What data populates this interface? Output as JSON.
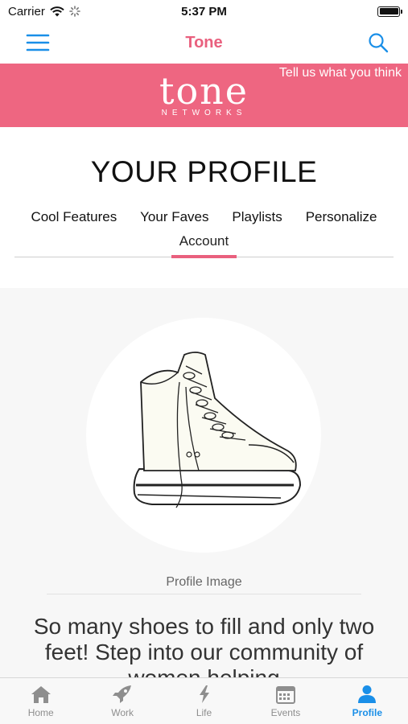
{
  "status_bar": {
    "carrier": "Carrier",
    "time": "5:37 PM"
  },
  "nav": {
    "title": "Tone",
    "menu_icon": "hamburger-menu-icon",
    "search_icon": "search-icon"
  },
  "banner": {
    "feedback_link": "Tell us what you think",
    "logo_text": "tone",
    "logo_subtext": "NETWORKS",
    "color": "#ee6681"
  },
  "profile": {
    "heading": "YOUR PROFILE",
    "tabs": [
      {
        "label": "Cool Features"
      },
      {
        "label": "Your Faves"
      },
      {
        "label": "Playlists"
      },
      {
        "label": "Personalize"
      },
      {
        "label": "Account",
        "active": true
      }
    ],
    "image_caption": "Profile Image",
    "tagline": "So many shoes to fill and only two feet! Step into our community of women helping"
  },
  "tab_bar": {
    "items": [
      {
        "label": "Home",
        "icon": "home-icon"
      },
      {
        "label": "Work",
        "icon": "rocket-icon"
      },
      {
        "label": "Life",
        "icon": "lightning-icon"
      },
      {
        "label": "Events",
        "icon": "calendar-icon"
      },
      {
        "label": "Profile",
        "icon": "person-icon",
        "active": true
      }
    ]
  },
  "colors": {
    "accent": "#e9607e",
    "tab_active": "#1a8fe8",
    "nav_icon": "#1a8fe8"
  }
}
